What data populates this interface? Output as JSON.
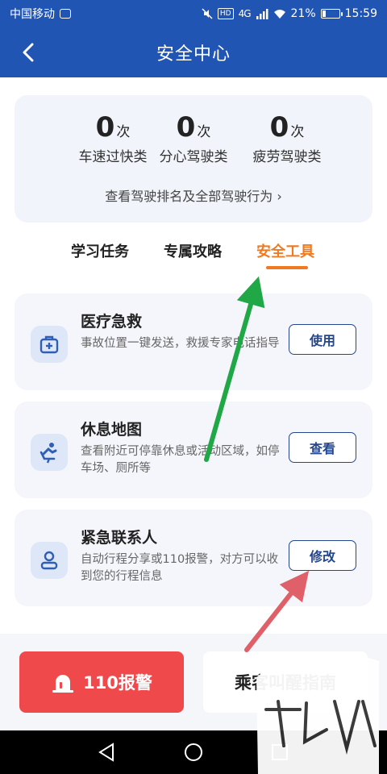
{
  "status_bar": {
    "carrier": "中国移动",
    "network_badge": "HD",
    "network_type": "4G",
    "battery": "21%",
    "battery_level": 0.21,
    "time": "15:59"
  },
  "header": {
    "title": "安全中心",
    "back_icon": "chevron-left-icon"
  },
  "stats": {
    "items": [
      {
        "value": "0",
        "unit": "次",
        "label": "车速过快类"
      },
      {
        "value": "0",
        "unit": "次",
        "label": "分心驾驶类"
      },
      {
        "value": "0",
        "unit": "次",
        "label": "疲劳驾驶类"
      }
    ],
    "link": "查看驾驶排名及全部驾驶行为 ›"
  },
  "tabs": {
    "items": [
      "学习任务",
      "专属攻略",
      "安全工具"
    ],
    "active_index": 2,
    "active_color": "#f07a22"
  },
  "tools": [
    {
      "title": "医疗急救",
      "description": "事故位置一键发送，救援专家电话指导",
      "button": "使用",
      "icon": "medical-kit-icon"
    },
    {
      "title": "休息地图",
      "description": "查看附近可停靠休息或活动区域，如停车场、厕所等",
      "button": "查看",
      "icon": "rest-seat-icon"
    },
    {
      "title": "紧急联系人",
      "description": "自动行程分享或110报警，对方可以收到您的行程信息",
      "button": "修改",
      "icon": "contact-person-icon"
    }
  ],
  "bottom": {
    "police_label": "110报警",
    "police_icon": "alarm-siren-icon",
    "guide_label": "乘客叫醒指南"
  },
  "colors": {
    "brand": "#2155b4",
    "alarm": "#f0494b",
    "button_border": "#24468c",
    "annotation_green": "#1fa845",
    "annotation_red": "#e0606a"
  }
}
